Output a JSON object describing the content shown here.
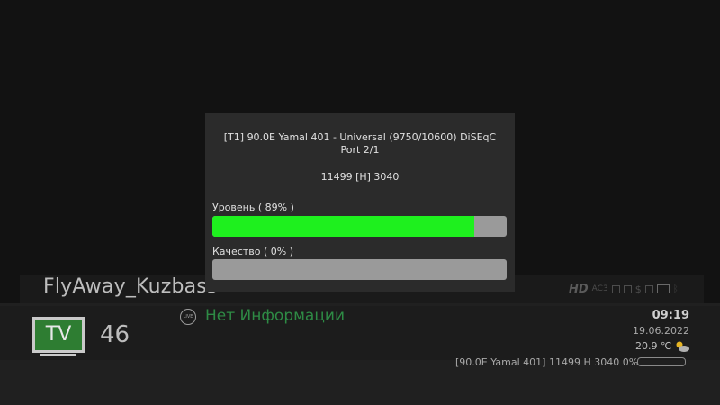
{
  "dialog": {
    "title": "[T1] 90.0E Yamal 401 - Universal (9750/10600) DiSEqC Port 2/1",
    "transponder": "11499 [H] 3040",
    "level": {
      "label": "Уровень  ( 89% )",
      "value": 0.89
    },
    "quality": {
      "label": "Качество  ( 0% )",
      "value": 0.0
    },
    "bar_color": "#1ef01e"
  },
  "banner": {
    "channel_name": "FlyAway_Kuzbass",
    "tv_badge": "TV",
    "channel_number": "46",
    "live_icon_text": "LIVE",
    "program_title": "Нет Информации",
    "time": "09:19",
    "date": "19.06.2022",
    "temperature": "20.9 ℃",
    "signal_info": "[90.0E Yamal 401] 11499 H 3040  0%",
    "signal_value": 0.0,
    "status_icons": {
      "hd": "HD",
      "ac3": "AC3",
      "icons": [
        "hd-icon",
        "ac3-icon",
        "subtitle-icon",
        "teletext-icon",
        "scrambled-icon",
        "lock-icon",
        "display-icon",
        "bluetooth-icon"
      ]
    }
  }
}
